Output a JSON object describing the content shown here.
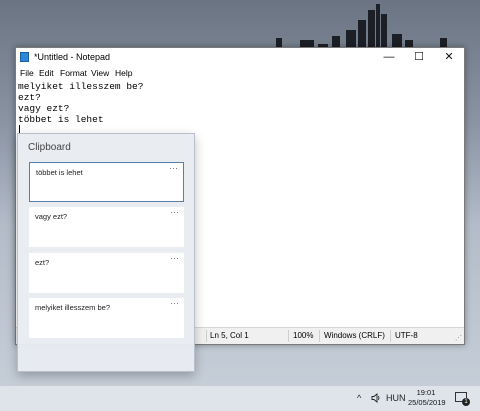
{
  "window": {
    "title": "*Untitled - Notepad",
    "buttons": {
      "minimize": "—",
      "maximize": "☐",
      "close": "✕"
    }
  },
  "menu": [
    "File",
    "Edit",
    "Format",
    "View",
    "Help"
  ],
  "editor": {
    "lines": [
      "melyiket illesszem be?",
      "ezt?",
      "vagy ezt?",
      "többet is lehet",
      ""
    ]
  },
  "status": {
    "position": "Ln 5, Col 1",
    "zoom": "100%",
    "line_ending": "Windows (CRLF)",
    "encoding": "UTF-8"
  },
  "clipboard": {
    "title": "Clipboard",
    "more_label": "···",
    "items": [
      "többet is lehet",
      "vagy ezt?",
      "ezt?",
      "melyiket illesszem be?"
    ]
  },
  "taskbar": {
    "chevron": "^",
    "language": "HUN",
    "time": "19:01",
    "date": "25/05/2019",
    "notification_count": "1"
  }
}
